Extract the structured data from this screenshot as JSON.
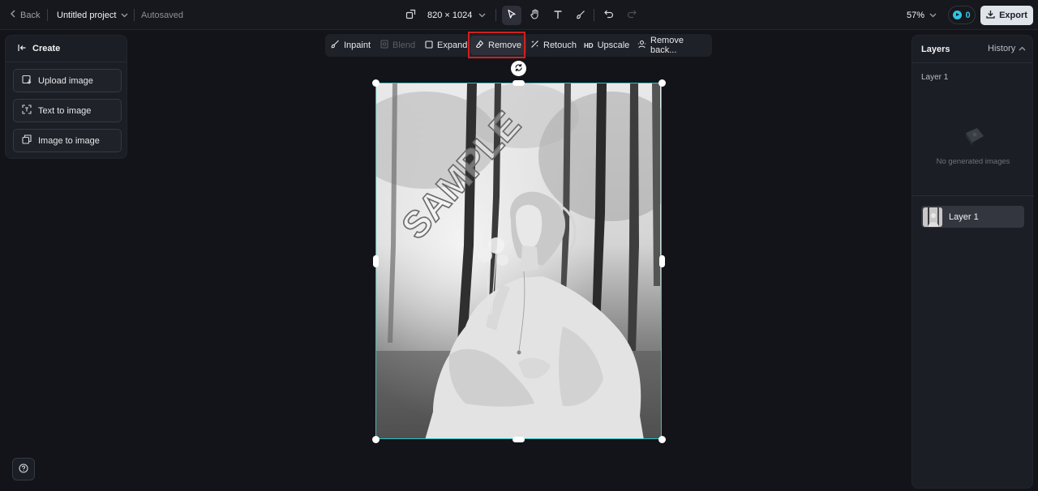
{
  "topbar": {
    "back_label": "Back",
    "project_name": "Untitled project",
    "autosave_status": "Autosaved",
    "canvas_size": "820 × 1024",
    "zoom": "57%",
    "credits": "0",
    "export_label": "Export"
  },
  "tools": [
    {
      "name": "select",
      "icon": "cursor-arrow-icon",
      "active": true
    },
    {
      "name": "hand",
      "icon": "hand-icon",
      "active": false
    },
    {
      "name": "text",
      "icon": "text-icon",
      "active": false
    },
    {
      "name": "brush",
      "icon": "brush-icon",
      "active": false
    },
    {
      "name": "undo",
      "icon": "undo-icon",
      "active": false
    },
    {
      "name": "redo",
      "icon": "redo-icon",
      "active": false
    }
  ],
  "create_panel": {
    "title": "Create",
    "buttons": [
      {
        "label": "Upload image",
        "icon": "upload-image-icon"
      },
      {
        "label": "Text to image",
        "icon": "text-to-image-icon"
      },
      {
        "label": "Image to image",
        "icon": "image-to-image-icon"
      }
    ]
  },
  "edit_toolbar": {
    "items": [
      {
        "label": "Inpaint",
        "icon": "inpaint-icon",
        "enabled": true
      },
      {
        "label": "Blend",
        "icon": "blend-icon",
        "enabled": false
      },
      {
        "label": "Expand",
        "icon": "expand-icon",
        "enabled": true
      },
      {
        "label": "Remove",
        "icon": "eraser-icon",
        "enabled": true,
        "selected": true
      },
      {
        "label": "Retouch",
        "icon": "retouch-icon",
        "enabled": true
      },
      {
        "label": "Upscale",
        "icon": "hd-icon",
        "enabled": true,
        "icon_text": "HD"
      },
      {
        "label": "Remove back...",
        "icon": "remove-background-icon",
        "enabled": true
      }
    ]
  },
  "canvas": {
    "watermark": "SAMPLE",
    "frame_color": "#2bc4c4"
  },
  "layers_panel": {
    "title": "Layers",
    "history_label": "History",
    "section_label": "Layer 1",
    "empty_text": "No generated images",
    "layers": [
      {
        "name": "Layer 1"
      }
    ]
  },
  "colors": {
    "background": "#121419",
    "accent": "#2ec5e6",
    "highlight": "#d01f1f"
  }
}
